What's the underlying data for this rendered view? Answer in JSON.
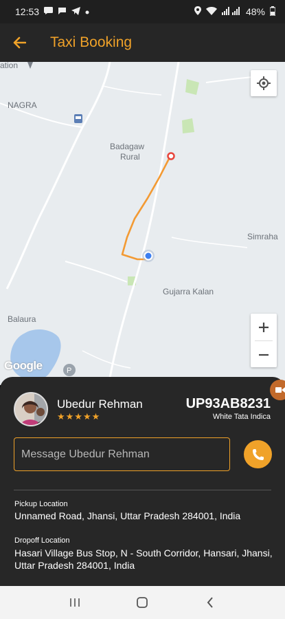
{
  "status_bar": {
    "time": "12:53",
    "battery": "48%",
    "left_icons": [
      "message-icon",
      "chat-icon",
      "telegram-icon",
      "dot-icon"
    ],
    "right_icons": [
      "location-icon",
      "wifi-icon",
      "signal-icon"
    ]
  },
  "app_bar": {
    "title": "Taxi Booking",
    "accent_color": "#f0a229"
  },
  "map": {
    "labels": {
      "nagra": "NAGRA",
      "badagaon": "Badagaw",
      "rural": "Rural",
      "simraha": "Simraha",
      "gujarra": "Gujarra Kalan",
      "balaura": "Balaura",
      "ation": "ation"
    },
    "google": "Google"
  },
  "driver": {
    "name": "Ubedur Rehman",
    "rating": "★★★★★",
    "plate": "UP93AB8231",
    "car": "White Tata Indica"
  },
  "message": {
    "placeholder": "Message Ubedur Rehman"
  },
  "pickup": {
    "label": "Pickup Location",
    "address": "Unnamed Road, Jhansi, Uttar Pradesh 284001, India"
  },
  "dropoff": {
    "label": "Dropoff Location",
    "address": "Hasari Village Bus Stop, N - South Corridor, Hansari, Jhansi, Uttar Pradesh 284001, India"
  }
}
